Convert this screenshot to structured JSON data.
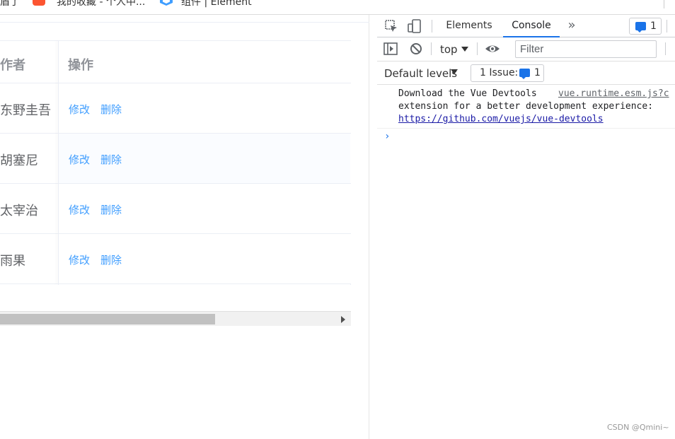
{
  "bookmarks": {
    "item1": "盾了",
    "item2": "我的收藏 - 个人中...",
    "item3": "组件 | Element"
  },
  "table": {
    "col_author": "作者",
    "col_actions": "操作",
    "rows": [
      {
        "author": "东野圭吾",
        "edit": "修改",
        "delete": "删除"
      },
      {
        "author": "胡塞尼",
        "edit": "修改",
        "delete": "删除"
      },
      {
        "author": "太宰治",
        "edit": "修改",
        "delete": "删除"
      },
      {
        "author": "雨果",
        "edit": "修改",
        "delete": "删除"
      }
    ]
  },
  "devtools": {
    "tabs": [
      "Elements",
      "Console"
    ],
    "active_tab": "Console",
    "more": "»",
    "badge_count": "1",
    "context": "top",
    "filter_placeholder": "Filter",
    "levels": "Default levels",
    "issues_label": "1 Issue:",
    "issues_count": "1",
    "message": {
      "line1": "Download the Vue Devtools",
      "source": "vue.runtime.esm.js?c",
      "line2": "extension for a better development experience:",
      "link": "https://github.com/vuejs/vue-devtools"
    },
    "prompt": "›"
  },
  "watermark": "CSDN @Qmini~",
  "colors": {
    "link_blue": "#409eff",
    "devtools_accent": "#1a73e8",
    "csdn_red": "#fc5531"
  }
}
